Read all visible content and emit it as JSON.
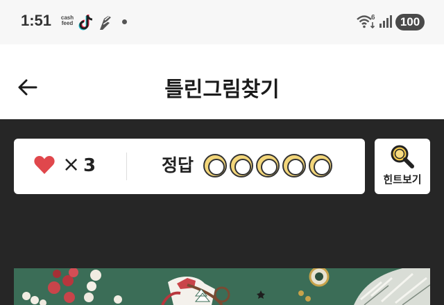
{
  "status_bar": {
    "time": "1:51",
    "cashfeed_line1": "cash",
    "cashfeed_line2": "feed",
    "wifi_label": "6",
    "battery": "100",
    "icons": [
      "cashfeed-icon",
      "tiktok-icon",
      "app-icon",
      "notification-dot-icon",
      "wifi-icon",
      "signal-icon",
      "battery-icon"
    ]
  },
  "header": {
    "title": "틀린그림찾기",
    "back_icon": "arrow-left-icon"
  },
  "game": {
    "lives_symbol": "×",
    "lives_count": "3",
    "answer_label": "정답",
    "answers_total": 5,
    "answers_found": 0,
    "hint_label": "힌트보기",
    "hint_icon": "magnifier-icon"
  },
  "colors": {
    "background": "#262626",
    "heart": "#e0474c",
    "answer_circle_ring": "#f3d67a",
    "hint_icon": "#f2c94c",
    "puzzle_green": "#3b6d57"
  }
}
